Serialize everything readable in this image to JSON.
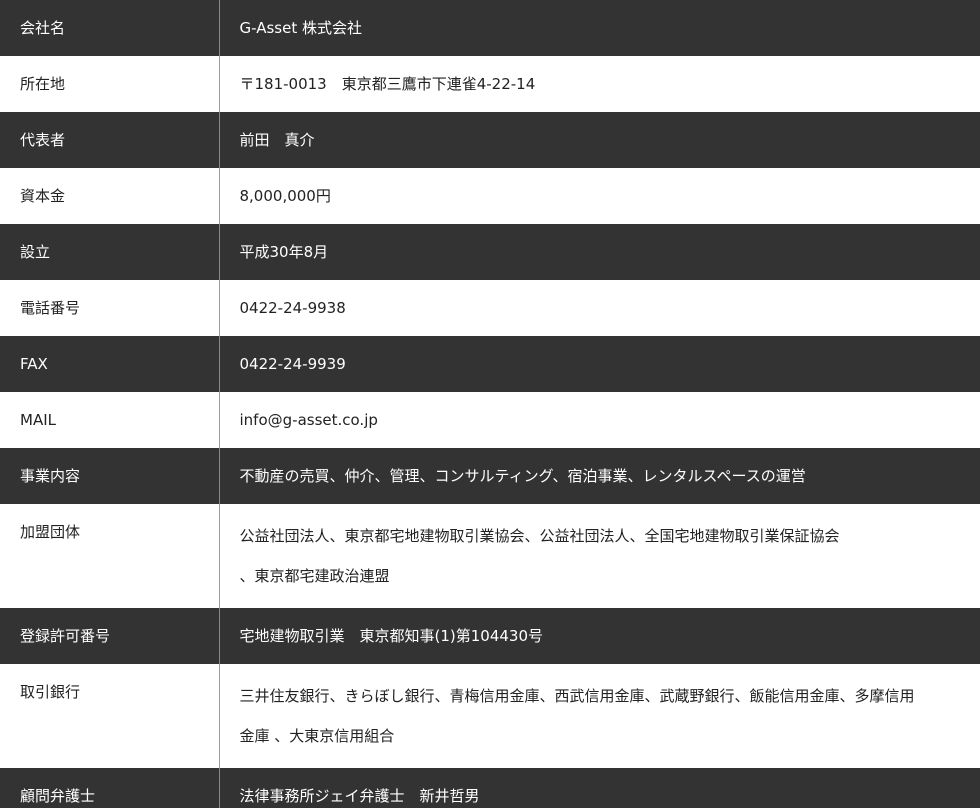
{
  "company_info": {
    "rows": [
      {
        "label": "会社名",
        "value": "G-Asset 株式会社"
      },
      {
        "label": "所在地",
        "value": "〒181-0013　東京都三鷹市下連雀4-22-14"
      },
      {
        "label": "代表者",
        "value": "前田　真介"
      },
      {
        "label": "資本金",
        "value": "8,000,000円"
      },
      {
        "label": "設立",
        "value": "平成30年8月"
      },
      {
        "label": "電話番号",
        "value": "0422-24-9938"
      },
      {
        "label": "FAX",
        "value": "0422-24-9939"
      },
      {
        "label": "MAIL",
        "value": "info@g-asset.co.jp"
      },
      {
        "label": "事業内容",
        "value": "不動産の売買、仲介、管理、コンサルティング、宿泊事業、レンタルスペースの運営"
      },
      {
        "label": "加盟団体",
        "value_line1": "公益社団法人、東京都宅地建物取引業協会、公益社団法人、全国宅地建物取引業保証協会",
        "value_line2": "、東京都宅建政治連盟"
      },
      {
        "label": "登録許可番号",
        "value": "宅地建物取引業　東京都知事(1)第104430号"
      },
      {
        "label": "取引銀行",
        "value_line1": "三井住友銀行、きらぼし銀行、青梅信用金庫、西武信用金庫、武蔵野銀行、飯能信用金庫、多摩信用",
        "value_line2": "金庫 、大東京信用組合"
      },
      {
        "label": "顧問弁護士",
        "value": "法律事務所ジェイ弁護士　新井哲男"
      }
    ]
  },
  "colors": {
    "dark_row": "#333333",
    "light_row": "#ffffff"
  }
}
